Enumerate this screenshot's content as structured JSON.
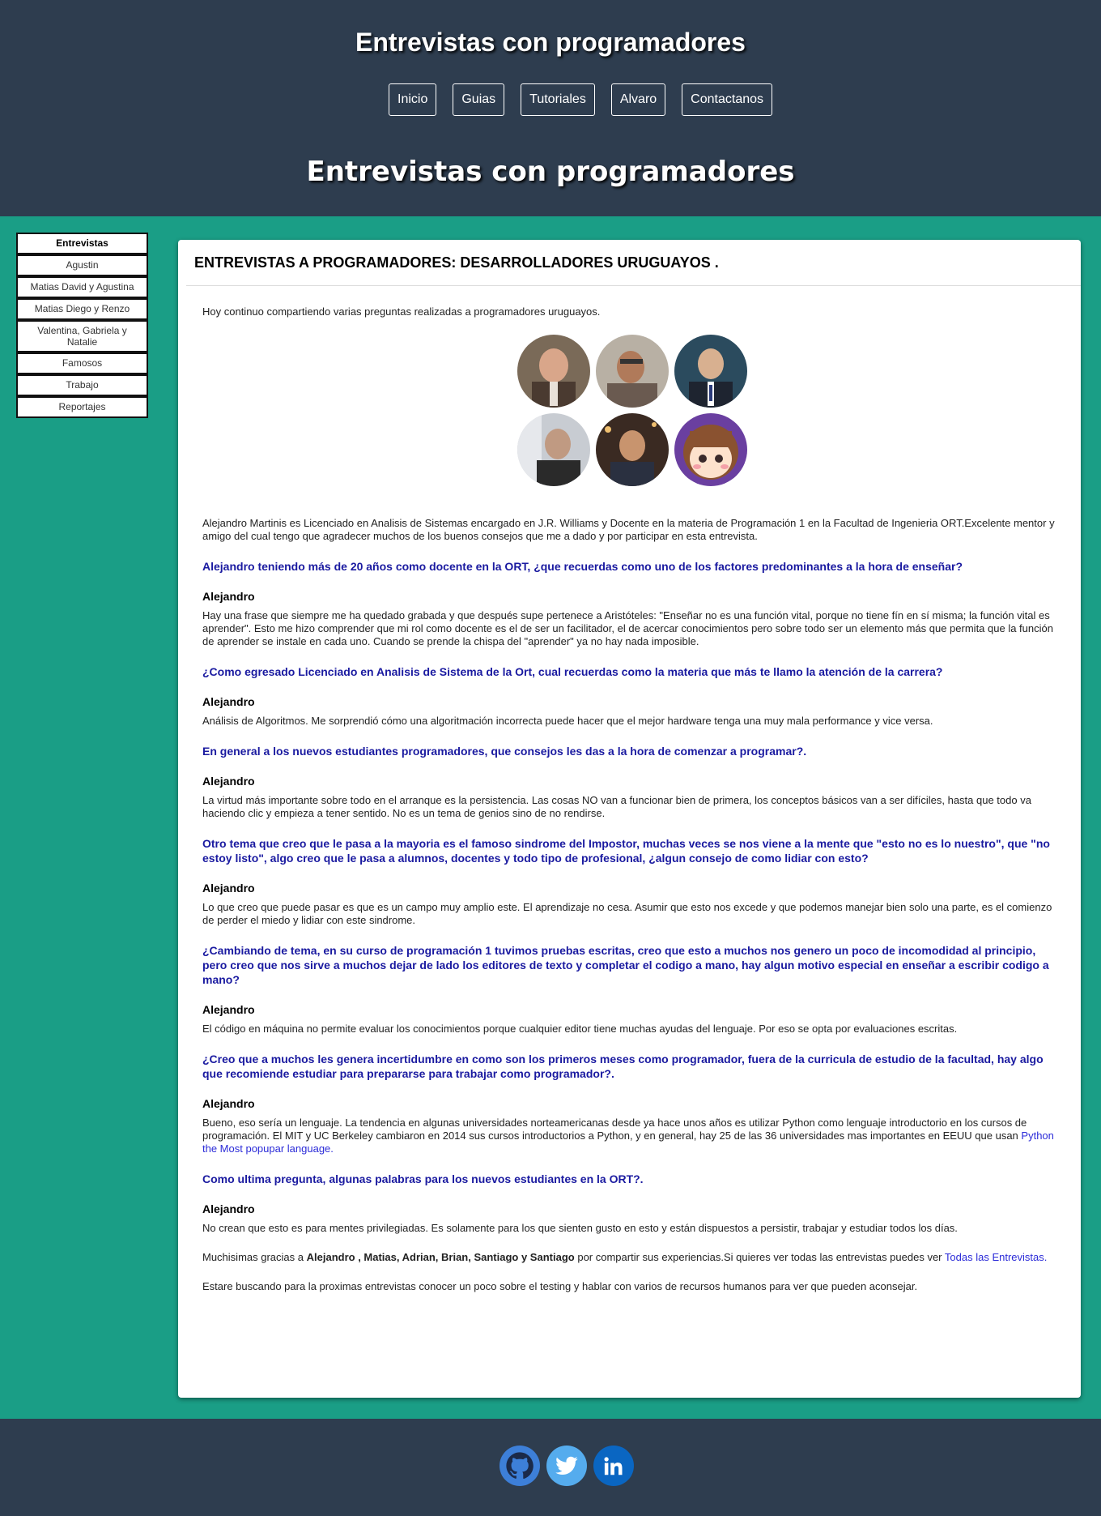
{
  "header": {
    "site_title": "Entrevistas con programadores",
    "nav": [
      "Inicio",
      "Guias",
      "Tutoriales",
      "Alvaro",
      "Contactanos"
    ],
    "hero_title": "Entrevistas con programadores"
  },
  "sidebar": {
    "items": [
      "Entrevistas",
      "Agustin",
      "Matias David y Agustina",
      "Matias Diego y Renzo",
      "Valentina, Gabriela y Natalie",
      "Famosos",
      "Trabajo",
      "Reportajes"
    ]
  },
  "article": {
    "title": "ENTREVISTAS A PROGRAMADORES: DESARROLLADORES URUGUAYOS .",
    "intro": "Hoy continuo compartiendo varias preguntas realizadas a programadores uruguayos.",
    "bio": "Alejandro Martinis es Licenciado en Analisis de Sistemas encargado en J.R. Williams y Docente en la materia de Programación 1 en la Facultad de Ingenieria ORT.Excelente mentor y amigo del cual tengo que agradecer muchos de los buenos consejos que me a dado y por participar en esta entrevista.",
    "q1": "Alejandro teniendo más de 20 años como docente en la ORT, ¿que recuerdas como uno de los factores predominantes a la hora de enseñar?",
    "speaker": "Alejandro",
    "a1": "Hay una frase que siempre me ha quedado grabada y que después supe pertenece a Aristóteles: \"Enseñar no es una función vital, porque no tiene fín en sí misma; la función vital es aprender\". Esto me hizo comprender que mi rol como docente es el de ser un facilitador, el de acercar conocimientos pero sobre todo ser un elemento más que permita que la función de aprender se instale en cada uno. Cuando se prende la chispa del \"aprender\" ya no hay nada imposible.",
    "q2": "¿Como egresado Licenciado en Analisis de Sistema de la Ort, cual recuerdas como la materia que más te llamo la atención de la carrera?",
    "a2": "Análisis de Algoritmos. Me sorprendió cómo una algoritmación incorrecta puede hacer que el mejor hardware tenga una muy mala performance y vice versa.",
    "q3": "En general a los nuevos estudiantes programadores, que consejos les das a la hora de comenzar a programar?.",
    "a3": "La virtud más importante sobre todo en el arranque es la persistencia. Las cosas NO van a funcionar bien de primera, los conceptos básicos van a ser difíciles, hasta que todo va haciendo clic y empieza a tener sentido. No es un tema de genios sino de no rendirse.",
    "q4": "Otro tema que creo que le pasa a la mayoria es el famoso sindrome del Impostor, muchas veces se nos viene a la mente que \"esto no es lo nuestro\", que \"no estoy listo\", algo creo que le pasa a alumnos, docentes y todo tipo de profesional, ¿algun consejo de como lidiar con esto?",
    "a4": "Lo que creo que puede pasar es que es un campo muy amplio este. El aprendizaje no cesa. Asumir que esto nos excede y que podemos manejar bien solo una parte, es el comienzo de perder el miedo y lidiar con este sindrome.",
    "q5": "¿Cambiando de tema, en su curso de programación 1 tuvimos pruebas escritas, creo que esto a muchos nos genero un poco de incomodidad al principio, pero creo que nos sirve a muchos dejar de lado los editores de texto y completar el codigo a mano, hay algun motivo especial en enseñar a escribir codigo a mano?",
    "a5": "El código en máquina no permite evaluar los conocimientos porque cualquier editor tiene muchas ayudas del lenguaje. Por eso se opta por evaluaciones escritas.",
    "q6": "¿Creo que a muchos les genera incertidumbre en como son los primeros meses como programador, fuera de la curricula de estudio de la facultad, hay algo que recomiende estudiar para prepararse para trabajar como programador?.",
    "a6": "Bueno, eso sería un lenguaje. La tendencia en algunas universidades norteamericanas desde ya hace unos años es utilizar Python como lenguaje introductorio en los cursos de programación. El MIT y UC Berkeley cambiaron en 2014 sus cursos introductorios a Python, y en general, hay 25 de las 36 universidades mas importantes en EEUU que usan",
    "a6_link": "Python the Most popupar language.",
    "q7": "Como ultima pregunta, algunas palabras para los nuevos estudiantes en la ORT?.",
    "a7": "No crean que esto es para mentes privilegiadas. Es solamente para los que sienten gusto en esto y están dispuestos a persistir, trabajar y estudiar todos los días.",
    "thanks_prefix": "Muchisimas gracias a",
    "thanks_names": "Alejandro , Matias, Adrian, Brian, Santiago y Santiago",
    "thanks_suffix": "por compartir sus experiencias.Si quieres ver todas las entrevistas puedes ver",
    "thanks_link": "Todas las Entrevistas.",
    "closing": "Estare buscando para la proximas entrevistas conocer un poco sobre el testing y hablar con varios de recursos humanos para ver que pueden aconsejar."
  },
  "footer": {
    "icons": [
      "github-icon",
      "twitter-icon",
      "linkedin-icon"
    ]
  },
  "colors": {
    "header_bg": "#2e3d4f",
    "page_bg": "#1a9e86",
    "question": "#1a1aa0",
    "link": "#2b2bd8"
  }
}
